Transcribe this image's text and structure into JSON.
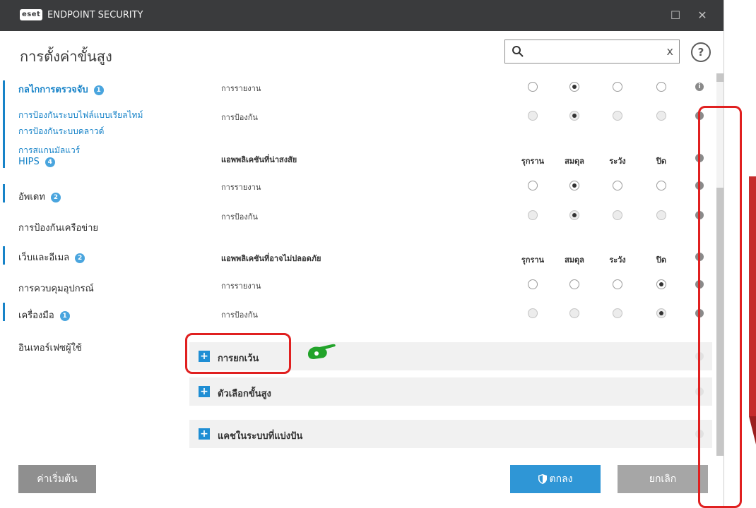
{
  "window": {
    "logo_text": "eset",
    "app_title": "ENDPOINT SECURITY",
    "maximize_glyph": "☐",
    "close_glyph": "✕"
  },
  "header": {
    "page_title": "การตั้งค่าขั้นสูง",
    "search_placeholder": "",
    "search_value": "",
    "clear_glyph": "x",
    "help_glyph": "?"
  },
  "sidebar": {
    "items": [
      {
        "label": "กลไกการตรวจจับ",
        "badge": "1",
        "active": true
      },
      {
        "label": "การป้องกันระบบไฟล์แบบเรียลไทม์"
      },
      {
        "label": "การป้องกันระบบคลาวด์"
      },
      {
        "label": "การสแกนมัลแวร์"
      },
      {
        "label": "HIPS",
        "badge": "4"
      },
      {
        "label": "อัพเดท",
        "badge": "2"
      },
      {
        "label": "การป้องกันเครือข่าย"
      },
      {
        "label": "เว็บและอีเมล",
        "badge": "2"
      },
      {
        "label": "การควบคุมอุปกรณ์"
      },
      {
        "label": "เครื่องมือ",
        "badge": "1"
      },
      {
        "label": "อินเทอร์เฟซผู้ใช้"
      }
    ]
  },
  "main": {
    "info_glyph": "i",
    "rows_top": [
      {
        "label": "การรายงาน",
        "selected": 1,
        "disabled": false
      },
      {
        "label": "การป้องกัน",
        "selected": 1,
        "disabled": true
      }
    ],
    "group1": {
      "title": "แอพพลิเคชันที่น่าสงสัย",
      "columns": [
        "รุกราน",
        "สมดุล",
        "ระวัง",
        "ปิด"
      ],
      "rows": [
        {
          "label": "การรายงาน",
          "selected": 1,
          "disabled": false
        },
        {
          "label": "การป้องกัน",
          "selected": 1,
          "disabled": true
        }
      ]
    },
    "group2": {
      "title": "แอพพลิเคชันที่อาจไม่ปลอดภัย",
      "columns": [
        "รุกราน",
        "สมดุล",
        "ระวัง",
        "ปิด"
      ],
      "rows": [
        {
          "label": "การรายงาน",
          "selected": 3,
          "disabled": false
        },
        {
          "label": "การป้องกัน",
          "selected": 3,
          "disabled": true
        }
      ]
    },
    "sections": [
      {
        "label": "การยกเว้น",
        "icon": "+"
      },
      {
        "label": "ตัวเลือกขั้นสูง",
        "icon": "+"
      },
      {
        "label": "แคชในระบบที่แบ่งปัน",
        "icon": "+"
      }
    ]
  },
  "footer": {
    "default_label": "ค่าเริ่มต้น",
    "ok_label": "ตกลง",
    "cancel_label": "ยกเลิก"
  },
  "colors": {
    "accent": "#1783c8",
    "titlebar": "#3a3b3d",
    "annotation": "#e02020",
    "annotation_hand": "#22a32a"
  }
}
